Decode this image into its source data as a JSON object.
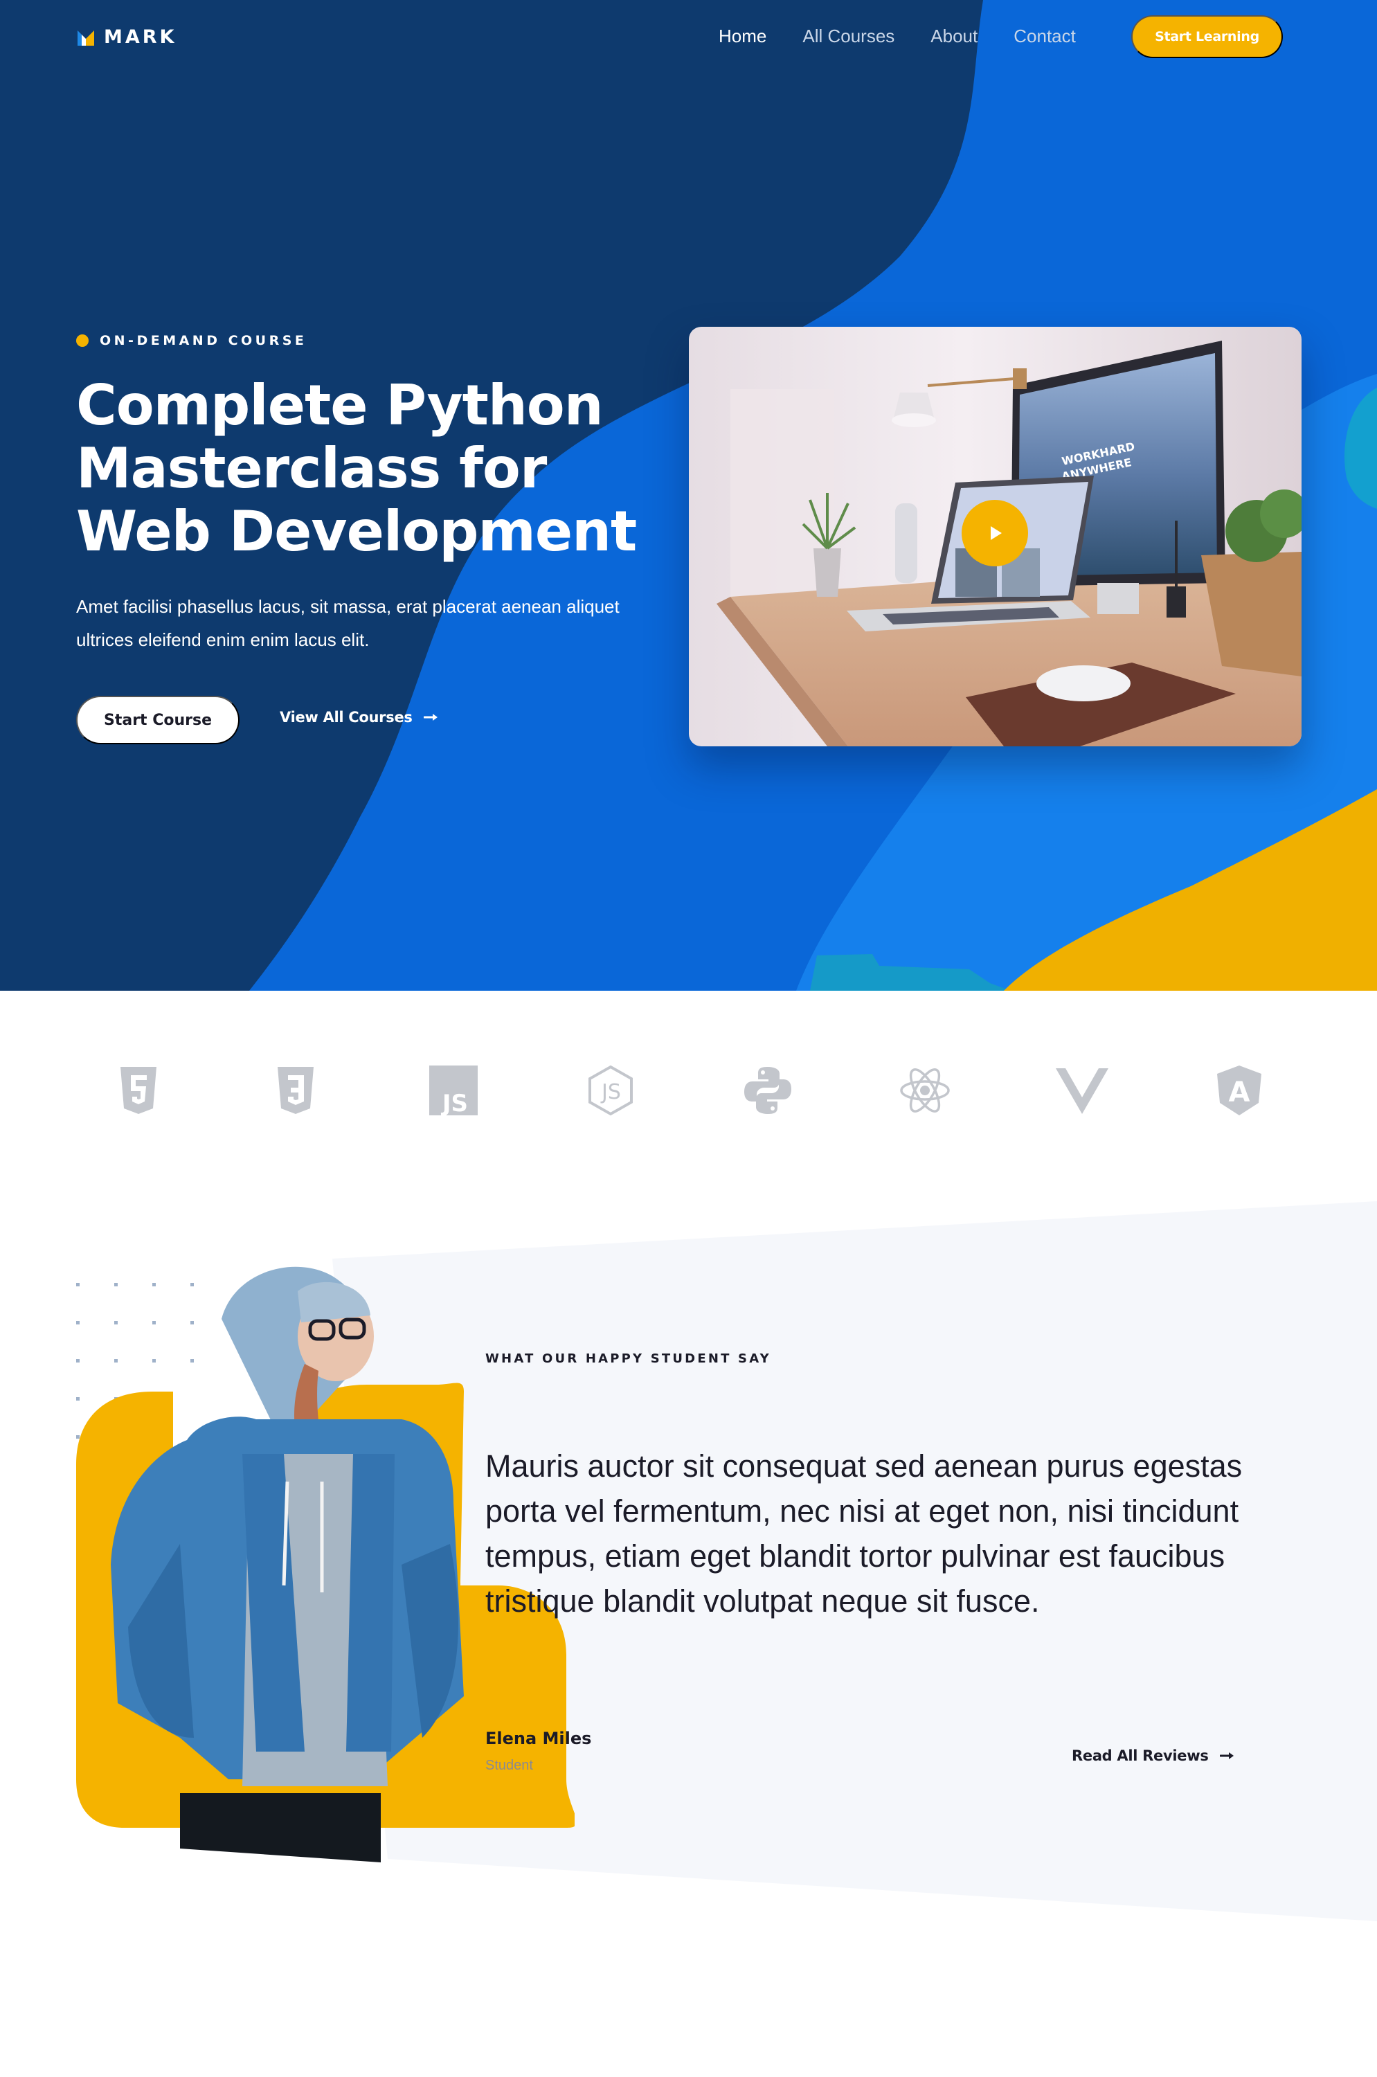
{
  "brand": {
    "name": "MARK",
    "colors": {
      "navy": "#0e3a6e",
      "blue": "#0a67d8",
      "bright_blue": "#1580ec",
      "yellow": "#f5b300",
      "ink": "#1b1b28",
      "muted": "#8a8a92",
      "panel": "#f5f7fb",
      "logo_gray": "#c3c6cc"
    }
  },
  "nav": {
    "links": [
      {
        "label": "Home",
        "active": true
      },
      {
        "label": "All Courses",
        "active": false
      },
      {
        "label": "About",
        "active": false
      },
      {
        "label": "Contact",
        "active": false
      }
    ],
    "cta_label": "Start Learning"
  },
  "hero": {
    "eyebrow": "ON-DEMAND COURSE",
    "title_lines": [
      "Complete Python",
      "Masterclass for",
      "Web Development"
    ],
    "description": "Amet facilisi phasellus lacus, sit massa, erat placerat aenean aliquet ultrices eleifend enim enim lacus elit.",
    "primary_button": "Start Course",
    "secondary_link": "View All Courses",
    "video": {
      "screen_text": [
        "WORKHARD",
        "ANYWHERE"
      ],
      "play_icon": "play-icon"
    }
  },
  "tech_logos": [
    {
      "name": "HTML5",
      "icon": "html5-icon"
    },
    {
      "name": "CSS3",
      "icon": "css3-icon"
    },
    {
      "name": "JavaScript",
      "icon": "javascript-icon",
      "text": "JS"
    },
    {
      "name": "Node.js",
      "icon": "nodejs-icon",
      "text": "JS"
    },
    {
      "name": "Python",
      "icon": "python-icon"
    },
    {
      "name": "React",
      "icon": "react-icon"
    },
    {
      "name": "Vue",
      "icon": "vue-icon"
    },
    {
      "name": "Angular",
      "icon": "angular-icon",
      "text": "A"
    }
  ],
  "testimonial": {
    "eyebrow": "WHAT OUR HAPPY STUDENT SAY",
    "quote": "Mauris auctor sit consequat sed aenean purus egestas porta vel fermentum, nec nisi at eget non, nisi tincidunt tempus, etiam eget blandit tortor pulvinar est faucibus tristique blandit volutpat neque sit fusce.",
    "author_name": "Elena Miles",
    "author_role": "Student",
    "read_all_link": "Read All Reviews"
  }
}
